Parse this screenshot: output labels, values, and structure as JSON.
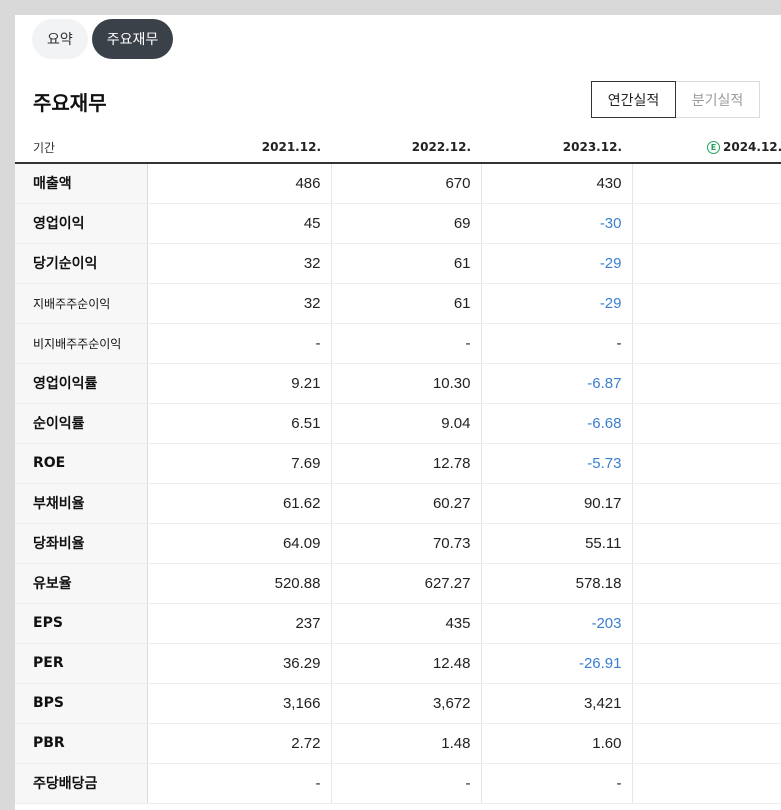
{
  "tabs": [
    {
      "label": "요약",
      "active": false
    },
    {
      "label": "주요재무",
      "active": true
    }
  ],
  "section_title": "주요재무",
  "period_toggle": [
    {
      "label": "연간실적",
      "active": true
    },
    {
      "label": "분기실적",
      "active": false
    }
  ],
  "table": {
    "header_label": "기간",
    "estimate_badge": "E",
    "columns": [
      "2021.12.",
      "2022.12.",
      "2023.12.",
      "2024.12."
    ],
    "rows": [
      {
        "label": "매출액",
        "values": [
          "486",
          "670",
          "430",
          "-"
        ]
      },
      {
        "label": "영업이익",
        "values": [
          "45",
          "69",
          "-30",
          "-"
        ]
      },
      {
        "label": "당기순이익",
        "values": [
          "32",
          "61",
          "-29",
          "-"
        ]
      },
      {
        "label": "지배주주순이익",
        "values": [
          "32",
          "61",
          "-29",
          "-"
        ]
      },
      {
        "label": "비지배주주순이익",
        "values": [
          "-",
          "-",
          "-",
          "-"
        ]
      },
      {
        "label": "영업이익률",
        "values": [
          "9.21",
          "10.30",
          "-6.87",
          "-"
        ]
      },
      {
        "label": "순이익률",
        "values": [
          "6.51",
          "9.04",
          "-6.68",
          "-"
        ]
      },
      {
        "label": "ROE",
        "values": [
          "7.69",
          "12.78",
          "-5.73",
          "-"
        ]
      },
      {
        "label": "부채비율",
        "values": [
          "61.62",
          "60.27",
          "90.17",
          "-"
        ]
      },
      {
        "label": "당좌비율",
        "values": [
          "64.09",
          "70.73",
          "55.11",
          "-"
        ]
      },
      {
        "label": "유보율",
        "values": [
          "520.88",
          "627.27",
          "578.18",
          "-"
        ]
      },
      {
        "label": "EPS",
        "values": [
          "237",
          "435",
          "-203",
          "-"
        ]
      },
      {
        "label": "PER",
        "values": [
          "36.29",
          "12.48",
          "-26.91",
          "-"
        ]
      },
      {
        "label": "BPS",
        "values": [
          "3,166",
          "3,672",
          "3,421",
          "-"
        ]
      },
      {
        "label": "PBR",
        "values": [
          "2.72",
          "1.48",
          "1.60",
          "-"
        ]
      },
      {
        "label": "주당배당금",
        "values": [
          "-",
          "-",
          "-",
          "-"
        ]
      }
    ]
  },
  "colors": {
    "negative": "#3a7fd0",
    "active_tab": "#3b4149",
    "estimate": "#1fa35c"
  }
}
